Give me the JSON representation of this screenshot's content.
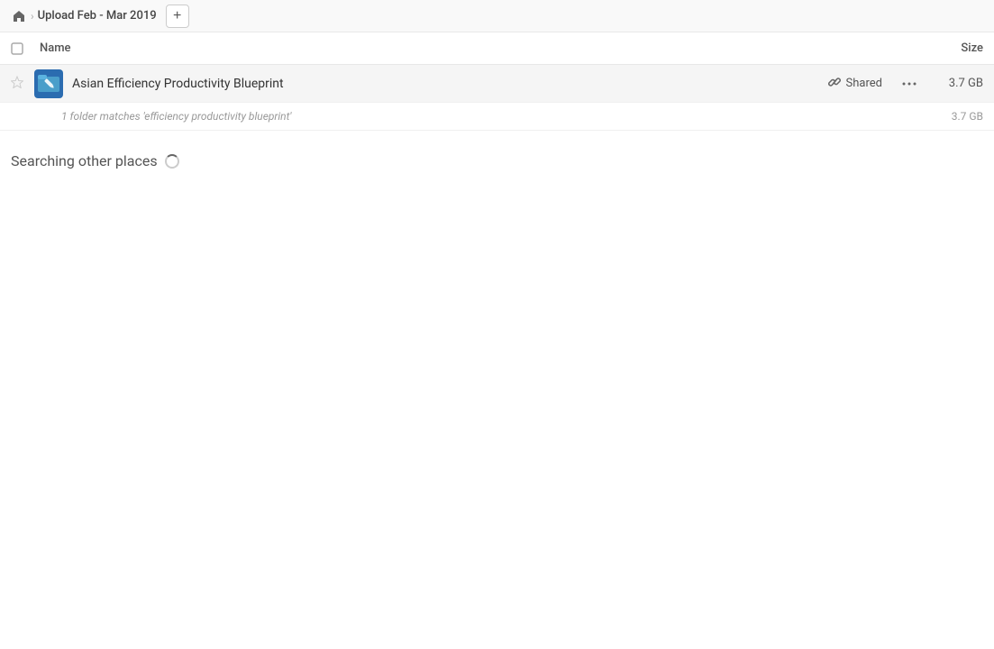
{
  "breadcrumb": {
    "title": "Upload Feb - Mar 2019",
    "add_button_label": "+"
  },
  "column_headers": {
    "name_label": "Name",
    "size_label": "Size"
  },
  "file_row": {
    "name": "Asian Efficiency Productivity Blueprint",
    "shared_label": "Shared",
    "size": "3.7 GB",
    "more_icon": "···"
  },
  "match_info": {
    "text": "1 folder matches 'efficiency productivity blueprint'",
    "size": "3.7 GB"
  },
  "searching": {
    "title": "Searching other places"
  }
}
